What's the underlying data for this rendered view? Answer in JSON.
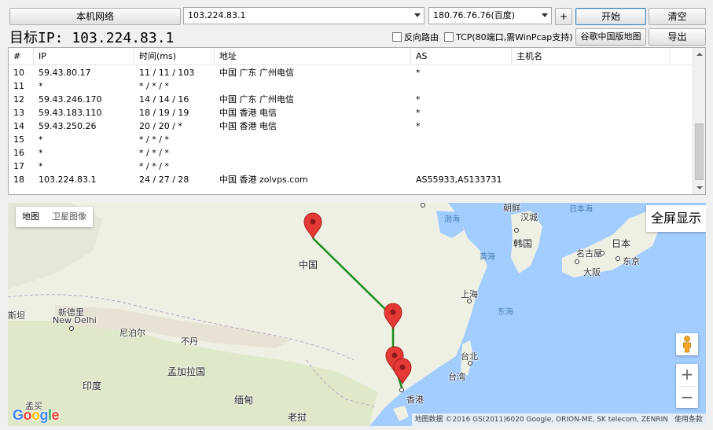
{
  "toolbar": {
    "local_network_label": "本机网络",
    "target_input_value": "103.224.83.1",
    "dns_select_value": "180.76.76.76(百度)",
    "add_label": "+",
    "start_label": "开始",
    "clear_label": "清空",
    "google_map_label": "谷歌中国版地图",
    "export_label": "导出"
  },
  "target": {
    "label": "目标IP: 103.224.83.1"
  },
  "options": {
    "reverse_route_label": "反向路由",
    "tcp_label": "TCP(80端口,需WinPcap支持)"
  },
  "table": {
    "columns": [
      "#",
      "IP",
      "时间(ms)",
      "地址",
      "AS",
      "主机名"
    ],
    "rows": [
      {
        "n": "10",
        "ip": "59.43.80.17",
        "time": "11 / 11 / 103",
        "addr": "中国 广东 广州电信",
        "as": "*",
        "host": ""
      },
      {
        "n": "11",
        "ip": "*",
        "time": "* / * / *",
        "addr": "",
        "as": "",
        "host": ""
      },
      {
        "n": "12",
        "ip": "59.43.246.170",
        "time": "14 / 14 / 16",
        "addr": "中国 广东 广州电信",
        "as": "*",
        "host": ""
      },
      {
        "n": "13",
        "ip": "59.43.183.110",
        "time": "18 / 19 / 19",
        "addr": "中国 香港 电信",
        "as": "*",
        "host": ""
      },
      {
        "n": "14",
        "ip": "59.43.250.26",
        "time": "20 / 20 / *",
        "addr": "中国 香港 电信",
        "as": "*",
        "host": ""
      },
      {
        "n": "15",
        "ip": "*",
        "time": "* / * / *",
        "addr": "",
        "as": "",
        "host": ""
      },
      {
        "n": "16",
        "ip": "*",
        "time": "* / * / *",
        "addr": "",
        "as": "",
        "host": ""
      },
      {
        "n": "17",
        "ip": "*",
        "time": "* / * / *",
        "addr": "",
        "as": "",
        "host": ""
      },
      {
        "n": "18",
        "ip": "103.224.83.1",
        "time": "24 / 27 / 28",
        "addr": "中国 香港 zolvps.com",
        "as": "AS55933,AS133731",
        "host": ""
      }
    ]
  },
  "map": {
    "type_map_label": "地图",
    "type_satellite_label": "卫星图像",
    "fullscreen_label": "全屏显示",
    "zoom_in_label": "+",
    "zoom_out_label": "−",
    "logo_text": "Google",
    "attribution": "地图数据 ©2016 GS(2011)6020 Google, ORION-ME, SK telecom, ZENRIN",
    "terms_label": "使用条款",
    "labels": {
      "china": "中国",
      "india": "印度",
      "new_delhi_zh": "新德里",
      "new_delhi_en": "New Delhi",
      "nepal": "尼泊尔",
      "bhutan": "不丹",
      "bangladesh": "孟加拉国",
      "myanmar": "缅甸",
      "laos": "老挝",
      "mumbai": "孟买",
      "pakistan_partial": "斯坦",
      "hong_kong": "香港",
      "shanghai": "上海",
      "taipei": "台北",
      "taiwan": "台湾",
      "seoul": "汉城",
      "korea": "韩国",
      "japan": "日本",
      "tokyo": "东京",
      "nagoya": "名古屋",
      "osaka": "大阪",
      "bohai": "渤海",
      "yellow_sea": "黄海",
      "east_sea": "东海",
      "sea_of_japan": "日本海",
      "north_korea_partial": "朝鲜"
    },
    "route_color": "#1a8a1a",
    "marker_color": "#e53935",
    "water_color": "#a3ccff",
    "land_color": "#f2efe9"
  }
}
